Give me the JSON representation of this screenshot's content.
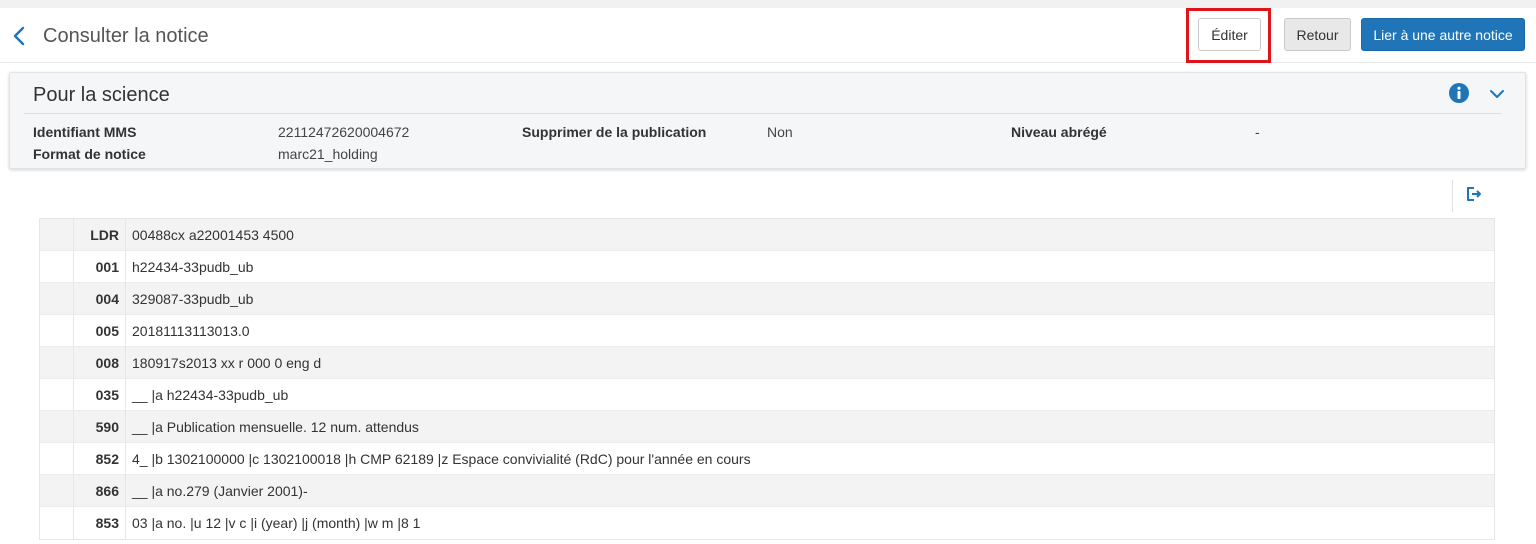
{
  "header": {
    "title": "Consulter la notice",
    "edit_label": "Éditer",
    "back_label": "Retour",
    "link_label": "Lier à une autre notice"
  },
  "record": {
    "title": "Pour la science",
    "fields": {
      "mms_id_label": "Identifiant MMS",
      "mms_id_value": "22112472620004672",
      "format_label": "Format de notice",
      "format_value": "marc21_holding",
      "suppress_label": "Supprimer de la publication",
      "suppress_value": "Non",
      "brief_label": "Niveau abrégé",
      "brief_value": "-"
    }
  },
  "icons": {
    "back": "chevron-left-icon",
    "info": "info-icon",
    "expand": "chevron-down-icon",
    "export": "export-icon"
  },
  "colors": {
    "primary": "#1f75b8",
    "highlight": "#e0151b"
  },
  "marc": [
    {
      "tag": "LDR",
      "content": "00488cx a22001453 4500"
    },
    {
      "tag": "001",
      "content": "h22434-33pudb_ub"
    },
    {
      "tag": "004",
      "content": "329087-33pudb_ub"
    },
    {
      "tag": "005",
      "content": "20181113113013.0"
    },
    {
      "tag": "008",
      "content": "180917s2013 xx r 000 0 eng d"
    },
    {
      "tag": "035",
      "content": "__ |a h22434-33pudb_ub"
    },
    {
      "tag": "590",
      "content": "__ |a Publication mensuelle. 12 num. attendus"
    },
    {
      "tag": "852",
      "content": "4_ |b 1302100000 |c 1302100018 |h CMP 62189 |z Espace convivialité (RdC) pour l'année en cours"
    },
    {
      "tag": "866",
      "content": "__ |a no.279 (Janvier 2001)-"
    },
    {
      "tag": "853",
      "content": "03 |a no. |u 12 |v c |i (year) |j (month) |w m |8 1"
    }
  ]
}
